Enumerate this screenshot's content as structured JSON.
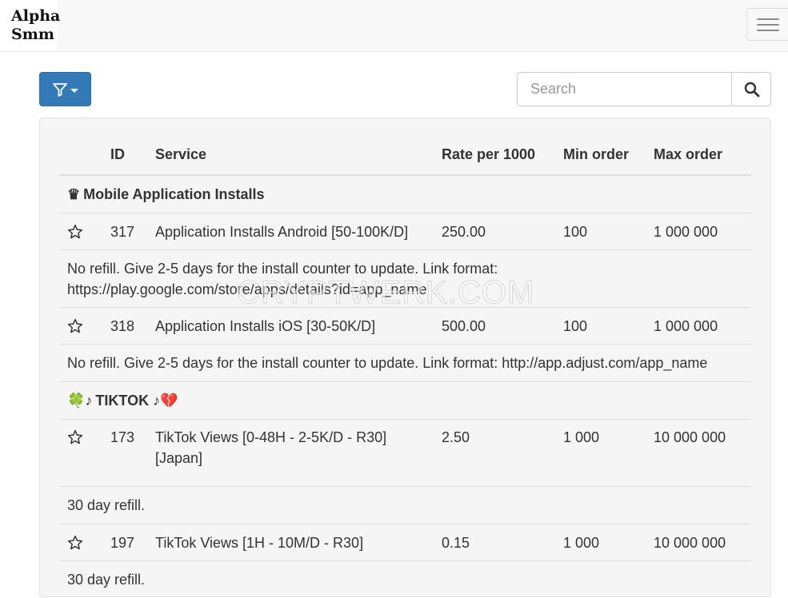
{
  "brand": {
    "logo_line1": "Alpha",
    "logo_line2": "Smm"
  },
  "toolbar": {
    "filter_icon": "filter-icon",
    "search_placeholder": "Search",
    "search_icon": "search-icon"
  },
  "table": {
    "headers": {
      "id": "ID",
      "service": "Service",
      "rate": "Rate per 1000",
      "min": "Min order",
      "max": "Max order"
    }
  },
  "categories": [
    {
      "icon": "♛",
      "name": "Mobile Application Installs",
      "services": [
        {
          "id": "317",
          "name": "Application Installs Android [50-100K/D]",
          "rate": "250.00",
          "min": "100",
          "max": "1 000 000",
          "description": "No refill. Give 2-5 days for the install counter to update. Link format: https://play.google.com/store/apps/details?id=app_name"
        },
        {
          "id": "318",
          "name": "Application Installs iOS [30-50K/D]",
          "rate": "500.00",
          "min": "100",
          "max": "1 000 000",
          "description": "No refill. Give 2-5 days for the install counter to update. Link format: http://app.adjust.com/app_name"
        }
      ]
    },
    {
      "icon": "🍀♪",
      "name": "TIKTOK ♪💔",
      "services": [
        {
          "id": "173",
          "name": "TikTok Views [0-48H - 2-5K/D - R30] [Japan]",
          "rate": "2.50",
          "min": "1 000",
          "max": "10 000 000",
          "description": "30 day refill."
        },
        {
          "id": "197",
          "name": "TikTok Views [1H - 10M/D - R30]",
          "rate": "0.15",
          "min": "1 000",
          "max": "10 000 000",
          "description": "30 day refill."
        }
      ]
    }
  ],
  "watermark": "CRYPTWERK.COM",
  "colors": {
    "primary": "#337ab7",
    "border": "#dddddd",
    "panel": "#f5f5f5"
  }
}
